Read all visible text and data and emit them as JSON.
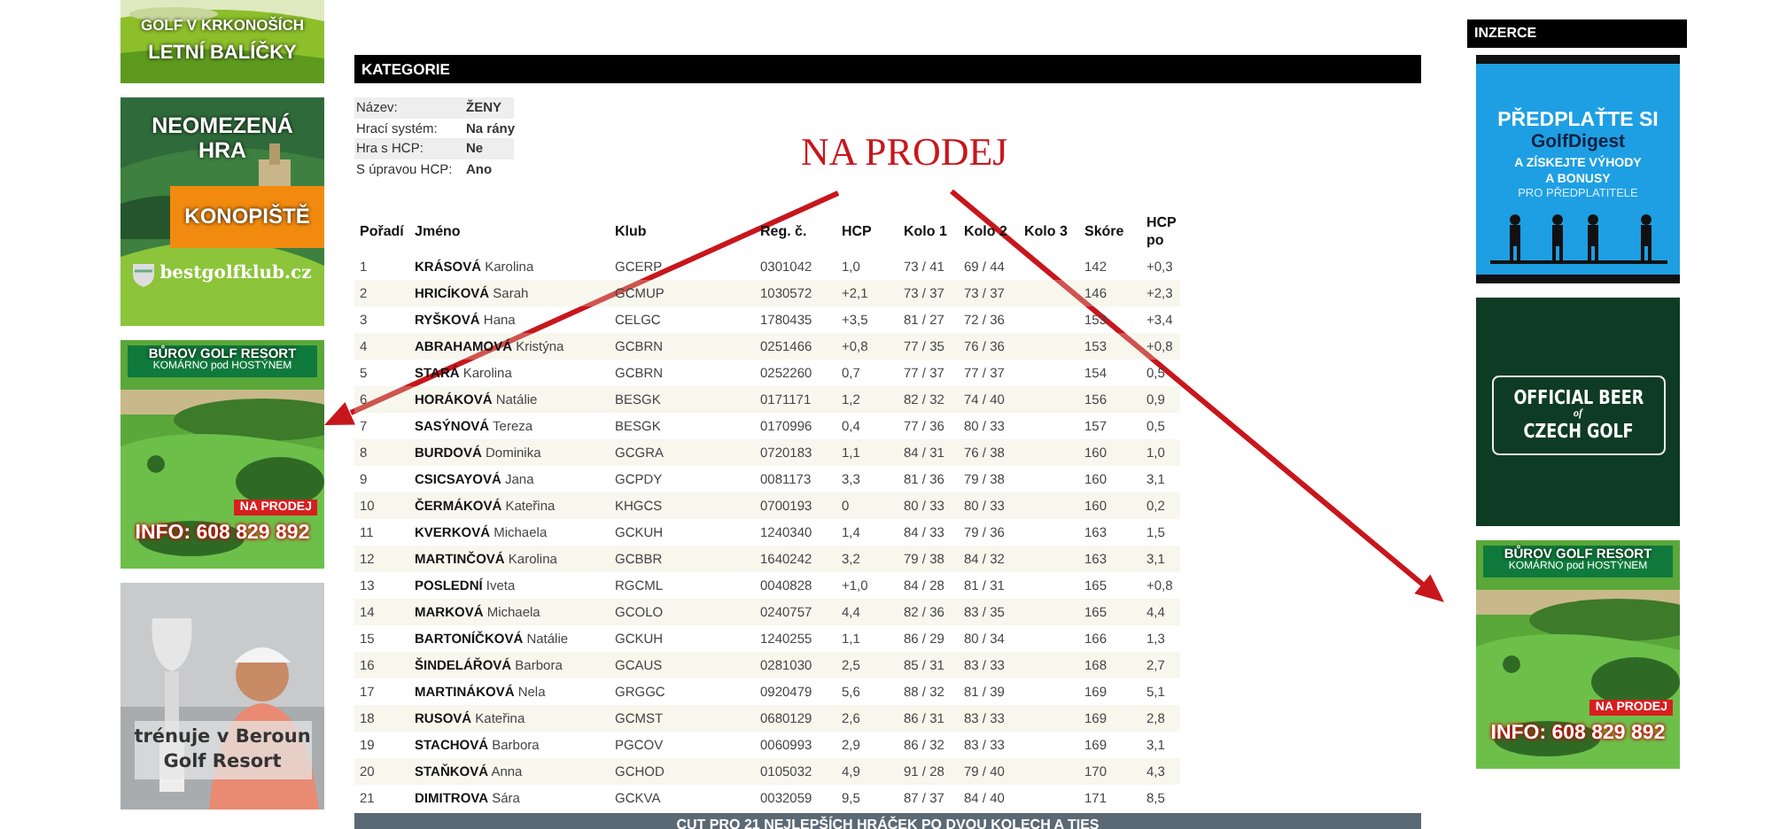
{
  "left_banners": [
    {
      "kind": "krkonose",
      "lines": [
        "GOLF V KRKONOŠÍCH",
        "LETNÍ BALÍČKY"
      ]
    },
    {
      "kind": "konopiste",
      "lines": [
        "NEOMEZENÁ HRA",
        "KONOPIŠTĚ",
        "bestgolfklub.cz"
      ]
    },
    {
      "kind": "burov",
      "lines": [
        "BŮROV GOLF RESORT",
        "KOMÁRNO pod HOSTÝNEM",
        "NA PRODEJ",
        "INFO: 608 829 892"
      ]
    },
    {
      "kind": "trophy",
      "lines": [
        "trénuje v Beroun Golf Resort"
      ]
    }
  ],
  "category": {
    "title": "KATEGORIE",
    "info": [
      {
        "label": "Název:",
        "value": "ŽENY"
      },
      {
        "label": "Hrací systém:",
        "value": "Na rány"
      },
      {
        "label": "Hra s HCP:",
        "value": "Ne"
      },
      {
        "label": "S úpravou HCP:",
        "value": "Ano"
      }
    ]
  },
  "table": {
    "columns": [
      "Pořadí",
      "Jméno",
      "Klub",
      "Reg. č.",
      "HCP",
      "Kolo 1",
      "Kolo 2",
      "Kolo 3",
      "Skóre",
      "HCP po"
    ],
    "rows": [
      [
        "1",
        "**KRÁSOVÁ** Karolina",
        "GCERP",
        "0301042",
        "1,0",
        "73 / 41",
        "69 / 44",
        "",
        "142",
        "+0,3"
      ],
      [
        "2",
        "**HRICÍKOVÁ** Sarah",
        "GCMUP",
        "1030572",
        "+2,1",
        "73 / 37",
        "73 / 37",
        "",
        "146",
        "+2,3"
      ],
      [
        "3",
        "**RYŠKOVÁ** Hana",
        "CELGC",
        "1780435",
        "+3,5",
        "81 / 27",
        "72 / 36",
        "",
        "153",
        "+3,4"
      ],
      [
        "4",
        "**ABRAHAMOVÁ** Kristýna",
        "GCBRN",
        "0251466",
        "+0,8",
        "77 / 35",
        "76 / 36",
        "",
        "153",
        "+0,8"
      ],
      [
        "5",
        "**STARÁ** Karolina",
        "GCBRN",
        "0252260",
        "0,7",
        "77 / 37",
        "77 / 37",
        "",
        "154",
        "0,5"
      ],
      [
        "6",
        "**HORÁKOVÁ** Natálie",
        "BESGK",
        "0171171",
        "1,2",
        "82 / 32",
        "74 / 40",
        "",
        "156",
        "0,9"
      ],
      [
        "7",
        "**SASÝNOVÁ** Tereza",
        "BESGK",
        "0170996",
        "0,4",
        "77 / 36",
        "80 / 33",
        "",
        "157",
        "0,5"
      ],
      [
        "8",
        "**BURDOVÁ** Dominika",
        "GCGRA",
        "0720183",
        "1,1",
        "84 / 31",
        "76 / 38",
        "",
        "160",
        "1,0"
      ],
      [
        "9",
        "**CSICSAYOVÁ** Jana",
        "GCPDY",
        "0081173",
        "3,3",
        "81 / 36",
        "79 / 38",
        "",
        "160",
        "3,1"
      ],
      [
        "10",
        "**ČERMÁKOVÁ** Kateřina",
        "KHGCS",
        "0700193",
        "0",
        "80 / 33",
        "80 / 33",
        "",
        "160",
        "0,2"
      ],
      [
        "11",
        "**KVERKOVÁ** Michaela",
        "GCKUH",
        "1240340",
        "1,4",
        "84 / 33",
        "79 / 36",
        "",
        "163",
        "1,5"
      ],
      [
        "12",
        "**MARTINČOVÁ** Karolina",
        "GCBBR",
        "1640242",
        "3,2",
        "79 / 38",
        "84 / 32",
        "",
        "163",
        "3,1"
      ],
      [
        "13",
        "**POSLEDNÍ** Iveta",
        "RGCML",
        "0040828",
        "+1,0",
        "84 / 28",
        "81 / 31",
        "",
        "165",
        "+0,8"
      ],
      [
        "14",
        "**MARKOVÁ** Michaela",
        "GCOLO",
        "0240757",
        "4,4",
        "82 / 36",
        "83 / 35",
        "",
        "165",
        "4,4"
      ],
      [
        "15",
        "**BARTONÍČKOVÁ** Natálie",
        "GCKUH",
        "1240255",
        "1,1",
        "86 / 29",
        "80 / 34",
        "",
        "166",
        "1,3"
      ],
      [
        "16",
        "**ŠINDELÁŘOVÁ** Barbora",
        "GCAUS",
        "0281030",
        "2,5",
        "85 / 31",
        "83 / 33",
        "",
        "168",
        "2,7"
      ],
      [
        "17",
        "**MARTINÁKOVÁ** Nela",
        "GRGGC",
        "0920479",
        "5,6",
        "88 / 32",
        "81 / 39",
        "",
        "169",
        "5,1"
      ],
      [
        "18",
        "**RUSOVÁ** Kateřina",
        "GCMST",
        "0680129",
        "2,6",
        "86 / 31",
        "83 / 33",
        "",
        "169",
        "2,8"
      ],
      [
        "19",
        "**STACHOVÁ** Barbora",
        "PGCOV",
        "0060993",
        "2,9",
        "86 / 32",
        "83 / 33",
        "",
        "169",
        "3,1"
      ],
      [
        "20",
        "**STAŇKOVÁ** Anna",
        "GCHOD",
        "0105032",
        "4,9",
        "91 / 28",
        "79 / 40",
        "",
        "170",
        "4,3"
      ],
      [
        "21",
        "**DIMITROVA** Sára",
        "GCKVA",
        "0032059",
        "9,5",
        "87 / 37",
        "84 / 40",
        "",
        "171",
        "8,5"
      ]
    ],
    "footer": "CUT PRO 21 NEJLEPŠÍCH HRÁČEK PO DVOU KOLECH A TIES"
  },
  "sidebar_title": "INZERCE",
  "right_banners": [
    {
      "kind": "golfdigest",
      "lines": [
        "PŘEDPLAŤTE SI",
        "GolfDigest",
        "A ZÍSKEJTE VÝHODY",
        "A BONUSY",
        "PRO PŘEDPLATITELE"
      ]
    },
    {
      "kind": "beer",
      "lines": [
        "OFFICIAL BEER",
        "of",
        "CZECH GOLF"
      ]
    },
    {
      "kind": "burov",
      "lines": [
        "BŮROV GOLF RESORT",
        "KOMÁRNO pod HOSTÝNEM",
        "NA PRODEJ",
        "INFO: 608 829 892"
      ]
    }
  ],
  "annotation": {
    "label": "NA PRODEJ"
  }
}
